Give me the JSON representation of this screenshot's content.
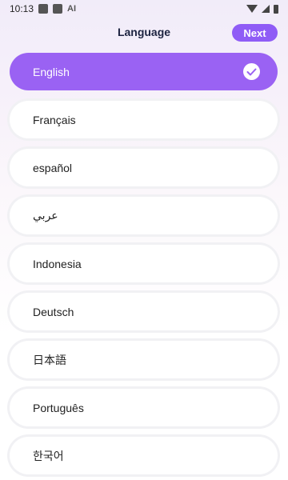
{
  "status_bar": {
    "time": "10:13",
    "ai_label": "AI"
  },
  "header": {
    "title": "Language",
    "next_label": "Next"
  },
  "colors": {
    "accent": "#8f5cf6",
    "selected_bg": "#9a62f3"
  },
  "languages": [
    {
      "label": "English",
      "selected": true
    },
    {
      "label": "Français",
      "selected": false
    },
    {
      "label": "español",
      "selected": false
    },
    {
      "label": "عربي",
      "selected": false
    },
    {
      "label": "Indonesia",
      "selected": false
    },
    {
      "label": "Deutsch",
      "selected": false
    },
    {
      "label": "日本語",
      "selected": false
    },
    {
      "label": "Português",
      "selected": false
    },
    {
      "label": "한국어",
      "selected": false
    }
  ]
}
